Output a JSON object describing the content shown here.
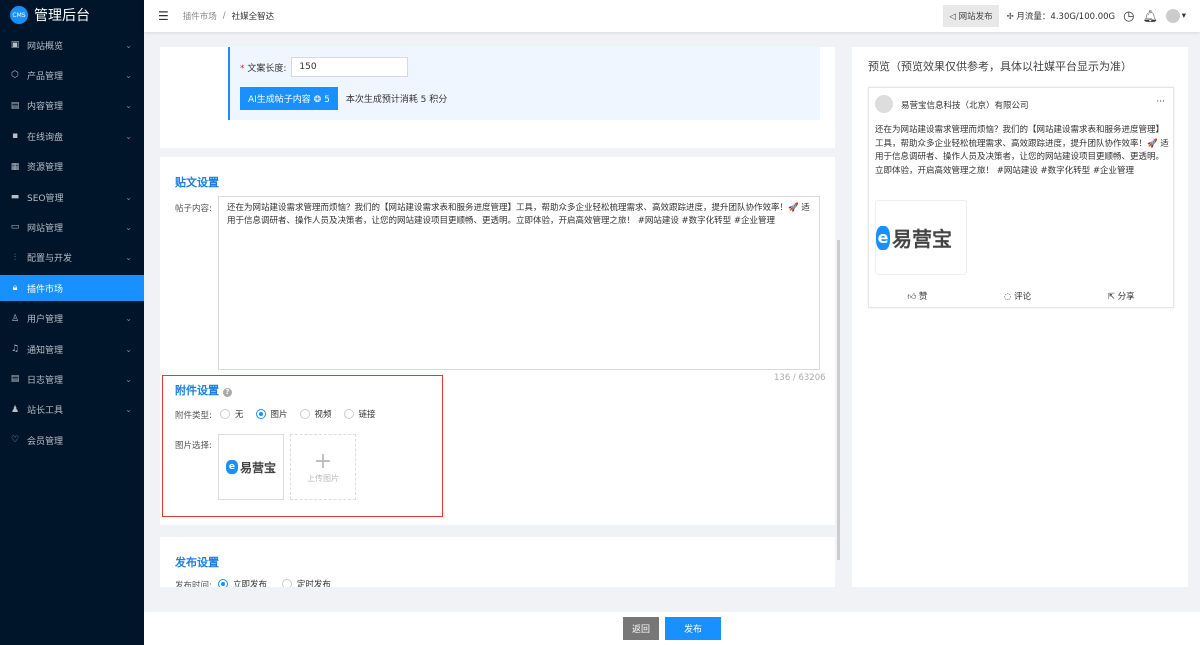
{
  "app": {
    "logo_badge": "CMS",
    "title": "管理后台"
  },
  "sidebar": {
    "items": [
      {
        "label": "网站概览",
        "icon": "monitor-icon"
      },
      {
        "label": "产品管理",
        "icon": "box-icon"
      },
      {
        "label": "内容管理",
        "icon": "document-icon"
      },
      {
        "label": "在线询盘",
        "icon": "chat-icon"
      },
      {
        "label": "资源管理",
        "icon": "folder-icon"
      },
      {
        "label": "SEO管理",
        "icon": "seo-icon"
      },
      {
        "label": "网站管理",
        "icon": "website-icon"
      },
      {
        "label": "配置与开发",
        "icon": "sliders-icon"
      },
      {
        "label": "插件市场",
        "icon": "lock-icon"
      },
      {
        "label": "用户管理",
        "icon": "user-icon"
      },
      {
        "label": "通知管理",
        "icon": "bell-icon"
      },
      {
        "label": "日志管理",
        "icon": "log-icon"
      },
      {
        "label": "站长工具",
        "icon": "tool-icon"
      },
      {
        "label": "会员管理",
        "icon": "member-icon"
      }
    ],
    "active": "插件市场"
  },
  "header": {
    "breadcrumb": [
      "插件市场",
      "社媒全智达"
    ],
    "publish_site": "网站发布",
    "traffic": "月流量：4.30G/100.00G"
  },
  "ai": {
    "length_label": "文案长度:",
    "length_value": "150",
    "generate_button": "AI生成帖子内容",
    "generate_cost": "5",
    "cost_note": "本次生成预计消耗 5 积分"
  },
  "post": {
    "title": "贴文设置",
    "content_label": "帖子内容:",
    "content": "还在为网站建设需求管理而烦恼？我们的【网站建设需求表和服务进度管理】工具，帮助众多企业轻松梳理需求、高效跟踪进度，提升团队协作效率！🚀 适用于信息调研者、操作人员及决策者，让您的网站建设项目更顺畅、更透明。立即体验，开启高效管理之旅！ #网站建设 #数字化转型 #企业管理",
    "counter": "136 / 63206"
  },
  "attachment": {
    "title": "附件设置",
    "type_label": "附件类型:",
    "types": [
      "无",
      "图片",
      "视频",
      "链接"
    ],
    "selected": "图片",
    "image_label": "图片选择:",
    "logo_text": "易营宝",
    "upload_label": "上传图片"
  },
  "publish": {
    "title": "发布设置",
    "time_label": "发布时间:",
    "options": [
      "立即发布",
      "定时发布"
    ],
    "selected": "立即发布"
  },
  "preview": {
    "title": "预览（预览效果仅供参考，具体以社媒平台显示为准）",
    "company": "易营宝信息科技（北京）有限公司",
    "more": "···",
    "like": "赞",
    "comment": "评论",
    "share": "分享"
  },
  "footer": {
    "back": "返回",
    "publish": "发布"
  }
}
